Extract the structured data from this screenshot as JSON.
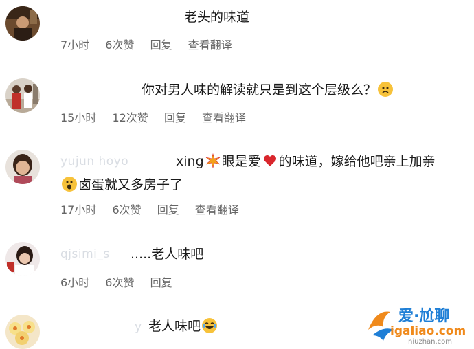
{
  "comments": [
    {
      "username": "",
      "text": "老头的味道",
      "time": "7小时",
      "likes": "6次赞",
      "reply": "回复",
      "translate": "查看翻译"
    },
    {
      "username": "",
      "text": "你对男人味的解读就只是到这个层级么？",
      "emoji": "sad-face-icon",
      "time": "15小时",
      "likes": "12次赞",
      "reply": "回复",
      "translate": "查看翻译"
    },
    {
      "username": "yujun hoyo",
      "text_part1": "xing",
      "emoji1": "sparkle-star-icon",
      "text_part2": "眼是爱",
      "emoji2": "red-heart-icon",
      "text_part3": "的味道，嫁给他吧亲上加亲",
      "emoji3": "surprised-face-icon",
      "text_part4": "卤蛋就又多房子了",
      "time": "17小时",
      "likes": "6次赞",
      "reply": "回复",
      "translate": "查看翻译"
    },
    {
      "username": "qjsimi_s",
      "text": ".....老人味吧",
      "time": "6小时",
      "likes": "6次赞",
      "reply": "回复"
    },
    {
      "username": "y",
      "text": "老人味吧",
      "emoji": "laughing-tears-face-icon"
    }
  ],
  "watermark": {
    "title": "爱·尬聊",
    "url": "igaliao.com",
    "sub": "niuzhan.com"
  },
  "colors": {
    "meta_gray": "#666666",
    "text": "#1a1a1a",
    "emoji_yellow": "#f7c23a",
    "heart_red": "#d9262c",
    "watermark_blue": "#1f7fd6",
    "watermark_orange": "#f08a1c"
  }
}
